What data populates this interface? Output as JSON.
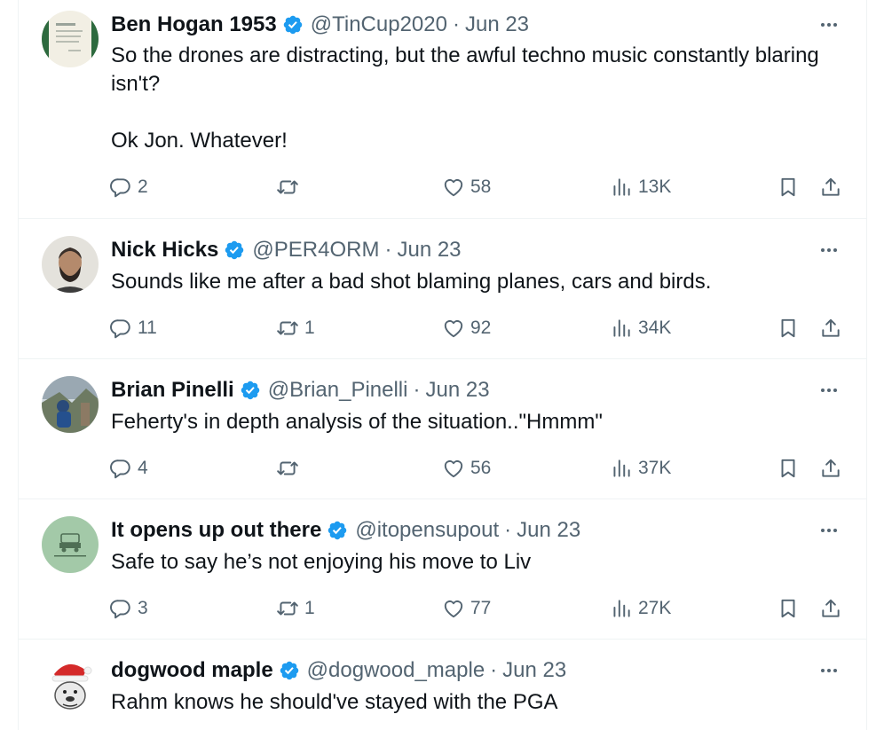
{
  "tweets": [
    {
      "name": "Ben Hogan 1953",
      "handle": "@TinCup2020",
      "date": "Jun 23",
      "text_lines": [
        "So the drones are distracting, but the awful techno music constantly blaring isn't?",
        "",
        "Ok Jon. Whatever!"
      ],
      "replies": "2",
      "retweets": "",
      "likes": "58",
      "views": "13K"
    },
    {
      "name": "Nick Hicks",
      "handle": "@PER4ORM",
      "date": "Jun 23",
      "text_lines": [
        "Sounds like me after a bad shot blaming planes, cars and birds."
      ],
      "replies": "11",
      "retweets": "1",
      "likes": "92",
      "views": "34K"
    },
    {
      "name": "Brian Pinelli",
      "handle": "@Brian_Pinelli",
      "date": "Jun 23",
      "text_lines": [
        "Feherty's in depth analysis of the situation..\"Hmmm\""
      ],
      "replies": "4",
      "retweets": "",
      "likes": "56",
      "views": "37K"
    },
    {
      "name": "It opens up out there",
      "handle": "@itopensupout",
      "date": "Jun 23",
      "text_lines": [
        "Safe to say he’s not enjoying his move to Liv"
      ],
      "replies": "3",
      "retweets": "1",
      "likes": "77",
      "views": "27K"
    },
    {
      "name": "dogwood maple",
      "handle": "@dogwood_maple",
      "date": "Jun 23",
      "text_lines": [
        "Rahm knows he should've stayed with the PGA"
      ]
    }
  ],
  "separator": "·",
  "colors": {
    "text": "#0f1419",
    "secondary": "#536471",
    "verified": "#1d9bf0",
    "border": "#eff3f4"
  },
  "icons": {
    "verified": "verified-badge-icon",
    "more": "more-dots-icon",
    "reply": "reply-icon",
    "retweet": "retweet-icon",
    "like": "heart-icon",
    "views": "views-chart-icon",
    "bookmark": "bookmark-icon",
    "share": "share-icon"
  }
}
